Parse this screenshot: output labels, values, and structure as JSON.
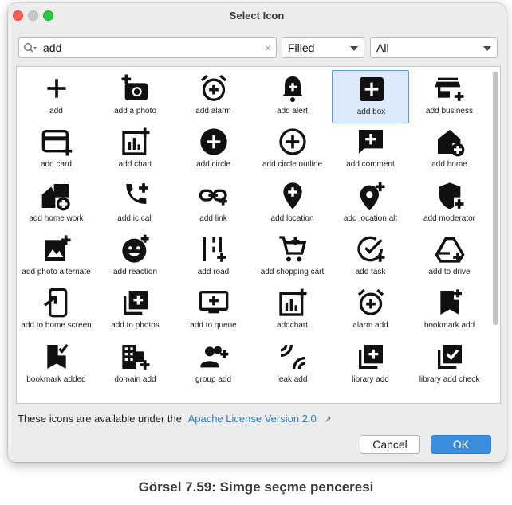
{
  "window": {
    "title": "Select Icon"
  },
  "search": {
    "value": "add",
    "clear_glyph": "×"
  },
  "style_select": {
    "selected": "Filled"
  },
  "category_select": {
    "selected": "All"
  },
  "icons": [
    {
      "label": "add",
      "icon": "add-icon"
    },
    {
      "label": "add a photo",
      "icon": "add-a-photo-icon"
    },
    {
      "label": "add alarm",
      "icon": "add-alarm-icon"
    },
    {
      "label": "add alert",
      "icon": "add-alert-icon"
    },
    {
      "label": "add box",
      "icon": "add-box-icon",
      "selected": true
    },
    {
      "label": "add business",
      "icon": "add-business-icon"
    },
    {
      "label": "add card",
      "icon": "add-card-icon"
    },
    {
      "label": "add chart",
      "icon": "add-chart-icon"
    },
    {
      "label": "add circle",
      "icon": "add-circle-icon"
    },
    {
      "label": "add circle outline",
      "icon": "add-circle-outline-icon"
    },
    {
      "label": "add comment",
      "icon": "add-comment-icon"
    },
    {
      "label": "add home",
      "icon": "add-home-icon"
    },
    {
      "label": "add home work",
      "icon": "add-home-work-icon"
    },
    {
      "label": "add ic call",
      "icon": "add-ic-call-icon"
    },
    {
      "label": "add link",
      "icon": "add-link-icon"
    },
    {
      "label": "add location",
      "icon": "add-location-icon"
    },
    {
      "label": "add location alt",
      "icon": "add-location-alt-icon"
    },
    {
      "label": "add moderator",
      "icon": "add-moderator-icon"
    },
    {
      "label": "add photo alternate",
      "icon": "add-photo-alternate-icon"
    },
    {
      "label": "add reaction",
      "icon": "add-reaction-icon"
    },
    {
      "label": "add road",
      "icon": "add-road-icon"
    },
    {
      "label": "add shopping cart",
      "icon": "add-shopping-cart-icon"
    },
    {
      "label": "add task",
      "icon": "add-task-icon"
    },
    {
      "label": "add to drive",
      "icon": "add-to-drive-icon"
    },
    {
      "label": "add to home screen",
      "icon": "add-to-home-screen-icon"
    },
    {
      "label": "add to photos",
      "icon": "add-to-photos-icon"
    },
    {
      "label": "add to queue",
      "icon": "add-to-queue-icon"
    },
    {
      "label": "addchart",
      "icon": "addchart-icon"
    },
    {
      "label": "alarm add",
      "icon": "alarm-add-icon"
    },
    {
      "label": "bookmark add",
      "icon": "bookmark-add-icon"
    },
    {
      "label": "bookmark added",
      "icon": "bookmark-added-icon"
    },
    {
      "label": "domain add",
      "icon": "domain-add-icon"
    },
    {
      "label": "group add",
      "icon": "group-add-icon"
    },
    {
      "label": "leak add",
      "icon": "leak-add-icon"
    },
    {
      "label": "library add",
      "icon": "library-add-icon"
    },
    {
      "label": "library add check",
      "icon": "library-add-check-icon"
    },
    {
      "label": "",
      "icon": "partial-icon"
    },
    {
      "label": "",
      "icon": "partial-icon"
    },
    {
      "label": "",
      "icon": "partial-icon"
    },
    {
      "label": "",
      "icon": "partial-icon"
    },
    {
      "label": "",
      "icon": "partial-icon"
    },
    {
      "label": "",
      "icon": "partial-icon"
    }
  ],
  "license": {
    "text": "These icons are available under the",
    "link": "Apache License Version 2.0",
    "ext_glyph": "↗"
  },
  "buttons": {
    "cancel": "Cancel",
    "ok": "OK"
  },
  "caption": "Görsel 7.59: Simge seçme penceresi",
  "colors": {
    "accent": "#3b8fde",
    "link": "#2f7bc6",
    "selection_bg": "#dbe9f8",
    "selection_border": "#5a9ad8"
  }
}
